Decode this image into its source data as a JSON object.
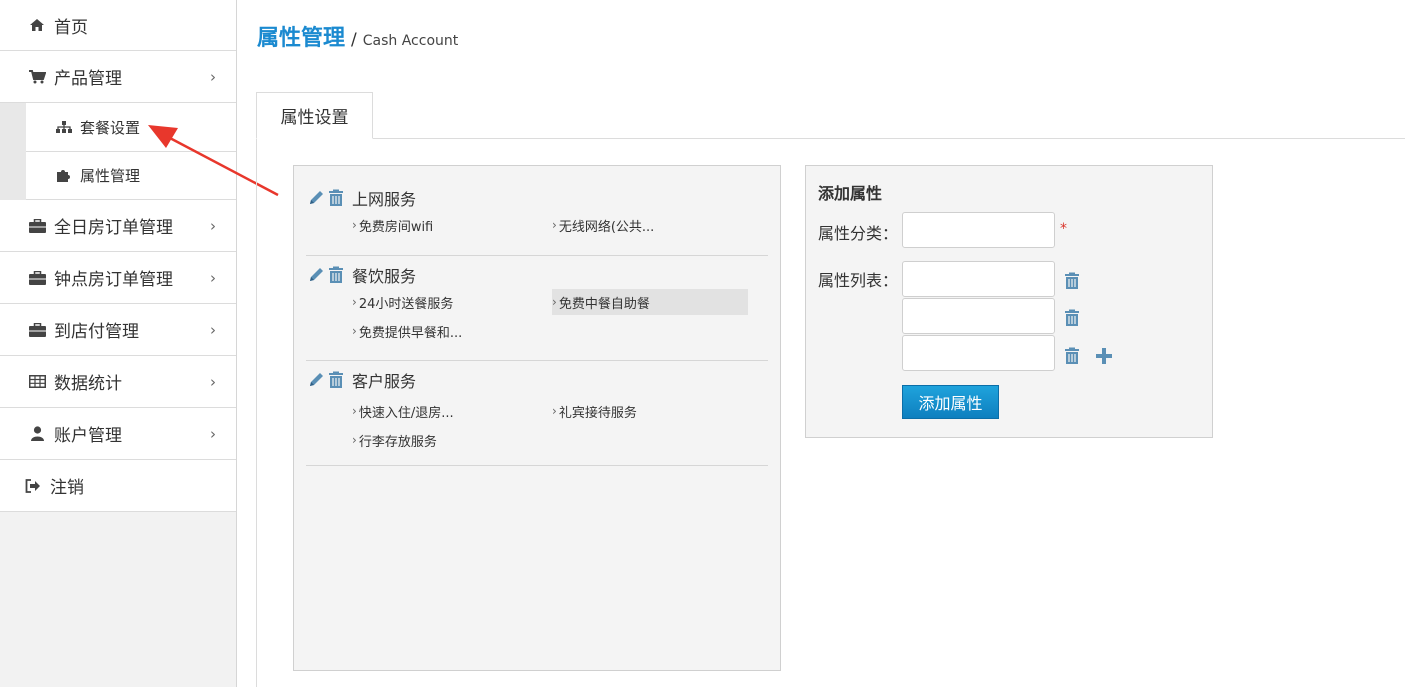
{
  "sidebar": {
    "items": [
      {
        "label": "首页",
        "icon": "home-icon"
      },
      {
        "label": "产品管理",
        "icon": "cart-icon"
      },
      {
        "label": "全日房订单管理",
        "icon": "briefcase-icon"
      },
      {
        "label": "钟点房订单管理",
        "icon": "briefcase-icon"
      },
      {
        "label": "到店付管理",
        "icon": "briefcase-icon"
      },
      {
        "label": "数据统计",
        "icon": "table-icon"
      },
      {
        "label": "账户管理",
        "icon": "user-icon"
      },
      {
        "label": "注销",
        "icon": "logout-icon"
      }
    ],
    "submenu": [
      {
        "label": "套餐设置",
        "icon": "sitemap-icon"
      },
      {
        "label": "属性管理",
        "icon": "puzzle-icon"
      }
    ],
    "chevron": "›"
  },
  "page": {
    "title": "属性管理",
    "separator": "/",
    "subtitle": "Cash Account"
  },
  "tabs": [
    {
      "label": "属性设置",
      "active": true
    }
  ],
  "attribute_groups": [
    {
      "name": "上网服务",
      "options": [
        "免费房间wifi",
        "无线网络(公共..."
      ]
    },
    {
      "name": "餐饮服务",
      "options": [
        "24小时送餐服务",
        "免费中餐自助餐",
        "免费提供早餐和..."
      ],
      "highlighted_index": 1
    },
    {
      "name": "客户服务",
      "options": [
        "快速入住/退房...",
        "礼宾接待服务",
        "行李存放服务"
      ]
    }
  ],
  "add_form": {
    "title": "添加属性",
    "category_label": "属性分类：",
    "list_label": "属性列表：",
    "required_mark": "*",
    "submit_label": "添加属性",
    "category_value": "",
    "list_values": [
      "",
      "",
      ""
    ]
  },
  "colors": {
    "accent": "#1b8ad0",
    "icon_blue": "#5a8fb5",
    "button_top": "#1fa3dc",
    "button_bottom": "#0e7fbf",
    "annotation_arrow": "#e8372c"
  }
}
